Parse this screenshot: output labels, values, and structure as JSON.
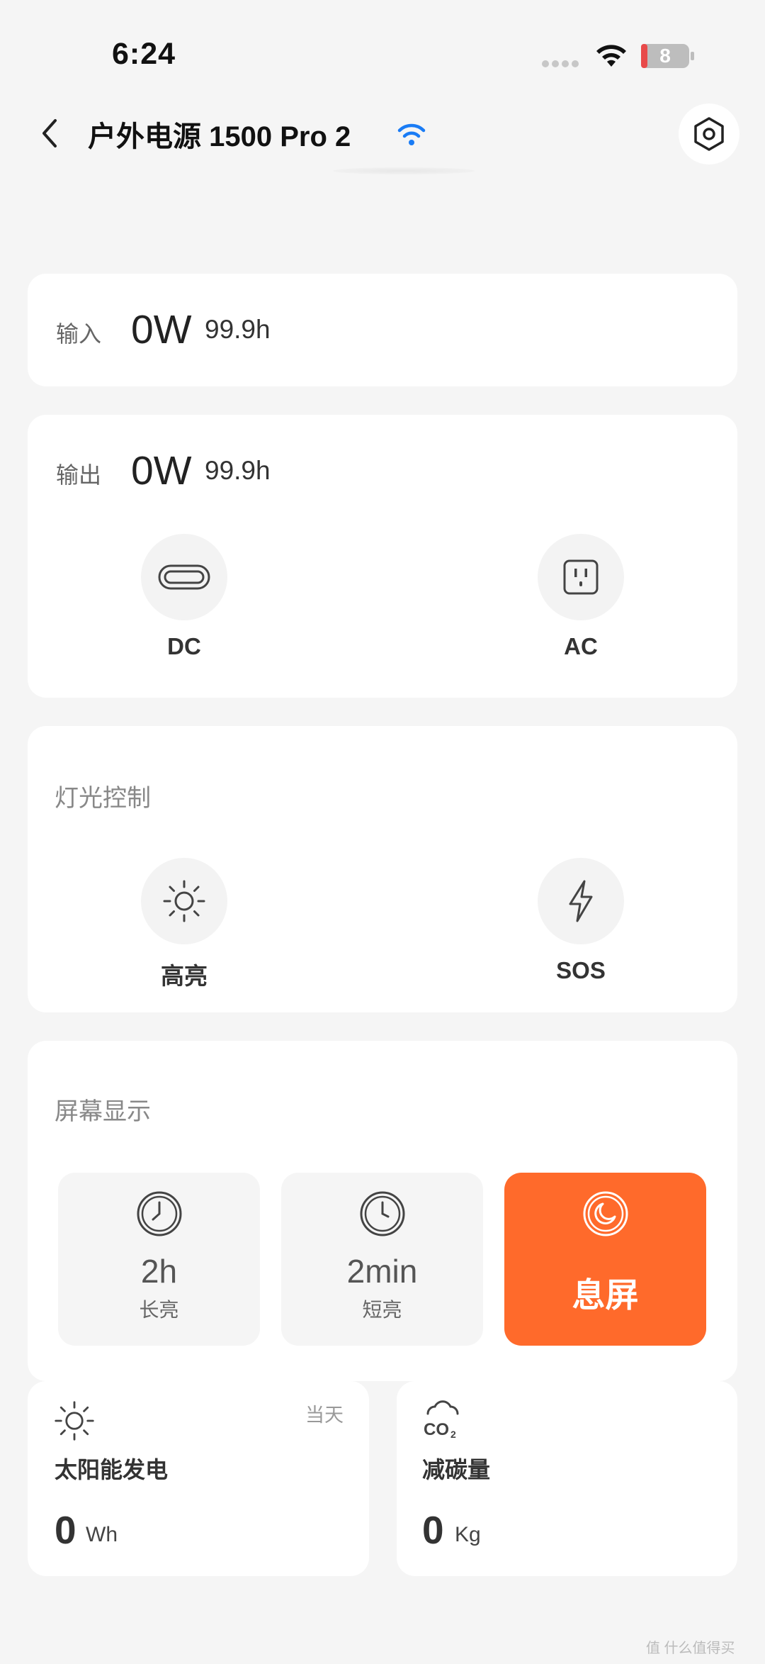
{
  "status_bar": {
    "time": "6:24",
    "battery": "8",
    "icons": [
      "signal-dots-icon",
      "wifi-icon",
      "battery-icon"
    ]
  },
  "nav": {
    "title": "户外电源 1500 Pro 2",
    "icons": [
      "back-chevron-icon",
      "wifi-icon",
      "settings-hexagon-icon"
    ]
  },
  "input": {
    "label": "输入",
    "power": "0W",
    "hours": "99.9h"
  },
  "output": {
    "label": "输出",
    "power": "0W",
    "hours": "99.9h",
    "ports": [
      {
        "label": "DC",
        "icon": "usb-c-port-icon"
      },
      {
        "label": "AC",
        "icon": "ac-outlet-icon"
      }
    ]
  },
  "light": {
    "title": "灯光控制",
    "modes": [
      {
        "label": "高亮",
        "icon": "sun-icon"
      },
      {
        "label": "SOS",
        "icon": "lightning-icon"
      }
    ]
  },
  "screen": {
    "title": "屏幕显示",
    "options": [
      {
        "main": "2h",
        "sub": "长亮",
        "icon": "clock-icon"
      },
      {
        "main": "2min",
        "sub": "短亮",
        "icon": "clock-icon"
      },
      {
        "main": "息屏",
        "icon": "moon-icon",
        "active": true
      }
    ]
  },
  "solar": {
    "title": "太阳能发电",
    "badge": "当天",
    "value": "0",
    "unit": "Wh",
    "icon": "sun-icon"
  },
  "co2": {
    "title": "减碳量",
    "value": "0",
    "unit": "Kg",
    "icon": "co2-cloud-icon"
  },
  "watermark": "值 什么值得买",
  "colors": {
    "accent": "#ff6a2b",
    "wifi_blue": "#1a7cf5",
    "background": "#f5f5f5",
    "battery_low": "#e84a4a"
  }
}
